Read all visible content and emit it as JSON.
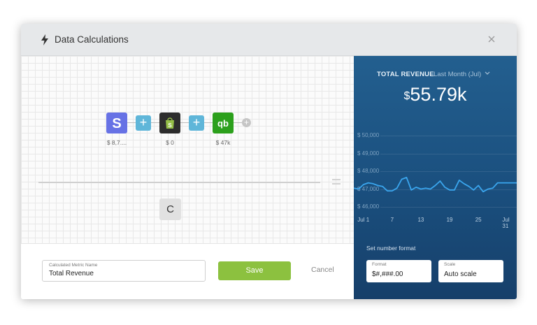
{
  "dialog": {
    "title": "Data Calculations",
    "icons": {
      "title": "lightning-bolt-icon",
      "close": "close-icon"
    }
  },
  "formula": {
    "sources": [
      {
        "name": "stripe",
        "icon": "stripe-icon",
        "value": "$ 8,7....",
        "color": "#6772e5"
      },
      {
        "name": "shopify",
        "icon": "shopify-icon",
        "value": "$ 0",
        "color": "#2d2d2d"
      },
      {
        "name": "quickbooks",
        "icon": "quickbooks-icon",
        "value": "$ 47k",
        "color": "#2ca01c"
      }
    ],
    "plus_label": "+",
    "add_label": "+",
    "clear_label": "C",
    "equals_icon": "equals-icon"
  },
  "footer": {
    "name_label": "Calculated Metric Name",
    "name_value": "Total Revenue",
    "save_label": "Save",
    "cancel_label": "Cancel"
  },
  "preview": {
    "metric_label": "TOTAL REVENUE",
    "period_label": "Last Month (Jul)",
    "currency": "$",
    "big_value": "55.79k",
    "format_section_label": "Set number format",
    "format_label": "Format",
    "format_value": "$#,###.00",
    "scale_label": "Scale",
    "scale_value": "Auto scale",
    "colors": {
      "background": "#1d5485",
      "line": "#3aa6ee"
    }
  },
  "chart_data": {
    "type": "line",
    "yticks": [
      "$ 50,000",
      "$ 49,000",
      "$ 48,000",
      "$ 47,000",
      "$ 46,000"
    ],
    "ylim": [
      46000,
      50000
    ],
    "xticks": [
      {
        "label": "Jul 1",
        "day": 1
      },
      {
        "label": "7",
        "day": 7
      },
      {
        "label": "13",
        "day": 13
      },
      {
        "label": "19",
        "day": 19
      },
      {
        "label": "25",
        "day": 25
      },
      {
        "label": "Jul 31",
        "day": 31
      }
    ],
    "xlim": [
      -1,
      33
    ],
    "series": [
      {
        "x": [
          -1,
          0,
          1,
          2,
          3,
          4,
          5,
          6,
          7,
          8,
          9,
          10,
          11,
          12,
          13,
          14,
          15,
          16,
          17,
          18,
          19,
          20,
          21,
          22,
          23,
          24,
          25,
          26,
          27,
          28,
          29,
          30,
          31,
          32,
          33
        ],
        "values": [
          47050,
          47000,
          47250,
          47350,
          47300,
          47200,
          47150,
          46900,
          46900,
          47050,
          47550,
          47650,
          46950,
          47100,
          47000,
          47050,
          47000,
          47200,
          47450,
          47100,
          46950,
          46950,
          47500,
          47300,
          47150,
          46950,
          47200,
          46850,
          47000,
          47050,
          47350,
          47350,
          47350,
          47350,
          47350
        ]
      }
    ]
  }
}
